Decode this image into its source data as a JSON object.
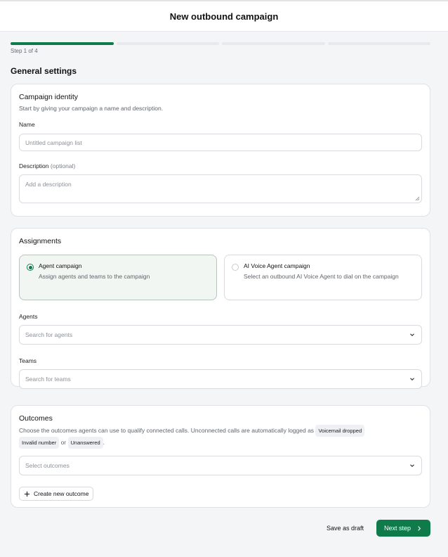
{
  "header": {
    "title": "New outbound campaign"
  },
  "progress": {
    "current_step": 1,
    "total_steps": 4,
    "label": "Step 1 of 4"
  },
  "page": {
    "section_title": "General settings"
  },
  "identity": {
    "title": "Campaign identity",
    "subtitle": "Start by giving your campaign a name and description.",
    "name_label": "Name",
    "name_placeholder": "Untitled campaign list",
    "description_label": "Description",
    "description_optional": "(optional)",
    "description_placeholder": "Add a description"
  },
  "assignments": {
    "title": "Assignments",
    "options": [
      {
        "title": "Agent campaign",
        "description": "Assign agents and teams to the campaign",
        "selected": true
      },
      {
        "title": "AI Voice Agent campaign",
        "description": "Select an outbound AI Voice Agent to dial on the campaign",
        "selected": false
      }
    ],
    "agents_label": "Agents",
    "agents_placeholder": "Search for agents",
    "teams_label": "Teams",
    "teams_placeholder": "Search for teams"
  },
  "outcomes": {
    "title": "Outcomes",
    "description": "Choose the outcomes agents can use to qualify connected calls. Unconnected calls are automatically logged as",
    "chips": [
      "Voicemail dropped",
      "Invalid number",
      "Unanswered"
    ],
    "or_text": "or",
    "period": ".",
    "select_placeholder": "Select outcomes",
    "create_label": "Create new outcome"
  },
  "footer": {
    "draft_label": "Save as draft",
    "next_label": "Next step"
  },
  "colors": {
    "accent": "#0f7a4a",
    "selected_bg": "#f1f6f3"
  }
}
